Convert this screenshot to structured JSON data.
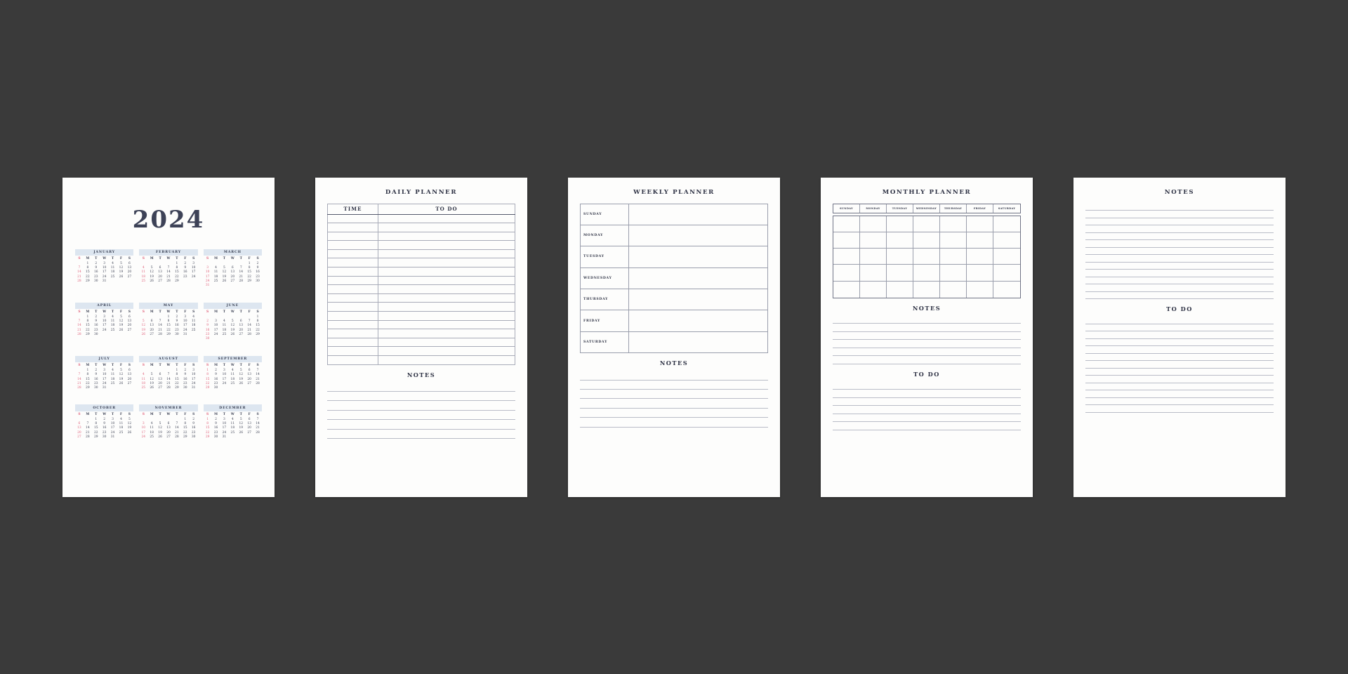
{
  "theme": {
    "background": "#3a3a3a",
    "paper": "#fdfdfc",
    "ink": "#2e3244",
    "accent_red": "#e0607a",
    "month_header_bg": "#dde6f0",
    "rule": "#b9bcc7"
  },
  "year_sheet": {
    "year_title": "2024",
    "dow_labels": [
      "S",
      "M",
      "T",
      "W",
      "T",
      "F",
      "S"
    ],
    "months": [
      {
        "name": "JANUARY",
        "lead": 1,
        "days": 31
      },
      {
        "name": "FEBRUARY",
        "lead": 4,
        "days": 29
      },
      {
        "name": "MARCH",
        "lead": 5,
        "days": 31
      },
      {
        "name": "APRIL",
        "lead": 1,
        "days": 30
      },
      {
        "name": "MAY",
        "lead": 3,
        "days": 31
      },
      {
        "name": "JUNE",
        "lead": 6,
        "days": 30
      },
      {
        "name": "JULY",
        "lead": 1,
        "days": 31
      },
      {
        "name": "AUGUST",
        "lead": 4,
        "days": 31
      },
      {
        "name": "SEPTEMBER",
        "lead": 0,
        "days": 30
      },
      {
        "name": "OCTOBER",
        "lead": 2,
        "days": 31
      },
      {
        "name": "NOVEMBER",
        "lead": 5,
        "days": 30
      },
      {
        "name": "DECEMBER",
        "lead": 0,
        "days": 31
      }
    ]
  },
  "daily_sheet": {
    "title": "DAILY PLANNER",
    "columns": [
      "TIME",
      "TO DO"
    ],
    "row_count": 17,
    "notes_title": "NOTES",
    "notes_line_count": 6
  },
  "weekly_sheet": {
    "title": "WEEKLY PLANNER",
    "days": [
      "SUNDAY",
      "MONDAY",
      "TUESDAY",
      "WEDNESDAY",
      "THURSDAY",
      "FRIDAY",
      "SATURDAY"
    ],
    "notes_title": "NOTES",
    "notes_line_count": 6
  },
  "monthly_sheet": {
    "title": "MONTHLY PLANNER",
    "weekday_headers": [
      "SUNDAY",
      "MONDAY",
      "TUESDAY",
      "WEDNESDAY",
      "THURSDAY",
      "FRIDAY",
      "SATURDAY"
    ],
    "grid_rows": 5,
    "grid_cols": 7,
    "notes_title": "NOTES",
    "notes_line_count": 6,
    "todo_title": "TO DO",
    "todo_line_count": 6
  },
  "notes_sheet": {
    "notes_title": "NOTES",
    "notes_line_count": 13,
    "todo_title": "TO DO",
    "todo_line_count": 13
  }
}
